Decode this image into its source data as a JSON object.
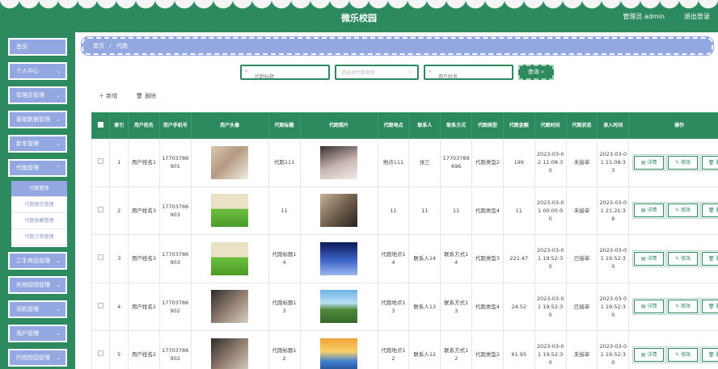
{
  "header": {
    "title": "微乐校园",
    "admin": "管理员 admin",
    "logout": "退出登录"
  },
  "sidebar": {
    "items": [
      {
        "label": "首页",
        "arrow": false
      },
      {
        "label": "个人中心",
        "arrow": true
      },
      {
        "label": "管理员管理",
        "arrow": true
      },
      {
        "label": "基础数据管理",
        "arrow": true
      },
      {
        "label": "新车管理",
        "arrow": true
      },
      {
        "label": "代跑管理",
        "arrow": true
      },
      {
        "label": "二手商品管理",
        "arrow": true
      },
      {
        "label": "失物招领管理",
        "arrow": true
      },
      {
        "label": "司机管理",
        "arrow": true
      },
      {
        "label": "用户管理",
        "arrow": true
      },
      {
        "label": "约拍校园管理",
        "arrow": true
      }
    ],
    "submenu": [
      "代跑管理",
      "代跑留言管理",
      "代跑收藏管理",
      "代跑订单管理"
    ]
  },
  "breadcrumb": {
    "home": "首页",
    "sep": "/",
    "current": "代跑"
  },
  "filters": {
    "title_placeholder": "代跑标题",
    "type_placeholder": "请选择代跑类型",
    "user_placeholder": "用户姓名",
    "search_label": "查询"
  },
  "toolbar": {
    "add": "新增",
    "delete": "删除"
  },
  "table": {
    "headers": [
      "索引",
      "用户姓名",
      "用户手机号",
      "用户头像",
      "代跑标题",
      "代跑照片",
      "代跑地点",
      "联系人",
      "联系方式",
      "代跑类型",
      "代跑金额",
      "代跑时间",
      "代跑状态",
      "录入时间",
      "操作"
    ],
    "actions": {
      "detail": "详情",
      "edit": "修改",
      "del": "删除"
    },
    "rows": [
      {
        "idx": "1",
        "name": "用户姓名1",
        "phone": "17703786901",
        "title": "代跑111",
        "place": "地点111",
        "contact": "张三",
        "tel": "17703789696",
        "type": "代跑类型2",
        "amount": "199",
        "time": "2023-03-02 11:08:30",
        "status": "未接单",
        "created": "2023-03-01 21:08:33"
      },
      {
        "idx": "2",
        "name": "用户姓名3",
        "phone": "17703786903",
        "title": "11",
        "place": "11",
        "contact": "11",
        "tel": "11",
        "type": "代跑类型4",
        "amount": "11",
        "time": "2023-03-01 00:00:00",
        "status": "未接单",
        "created": "2023-03-01 21:21:38"
      },
      {
        "idx": "3",
        "name": "用户姓名3",
        "phone": "17703786903",
        "title": "代跑标题14",
        "place": "代跑地点14",
        "contact": "联系人14",
        "tel": "联系方式14",
        "type": "代跑类型3",
        "amount": "221.47",
        "time": "2023-03-01 19:52:30",
        "status": "已接单",
        "created": "2023-03-01 19:52:30"
      },
      {
        "idx": "4",
        "name": "用户姓名2",
        "phone": "17703786902",
        "title": "代跑标题13",
        "place": "代跑地点13",
        "contact": "联系人13",
        "tel": "联系方式13",
        "type": "代跑类型4",
        "amount": "24.52",
        "time": "2023-03-01 19:52:30",
        "status": "已接单",
        "created": "2023-03-01 19:52:30"
      },
      {
        "idx": "5",
        "name": "用户姓名2",
        "phone": "17703786902",
        "title": "代跑标题12",
        "place": "代跑地点12",
        "contact": "联系人12",
        "tel": "联系方式12",
        "type": "代跑类型2",
        "amount": "61.95",
        "time": "2023-03-01 19:52:30",
        "status": "未接单",
        "created": "2023-03-01 19:52:30"
      }
    ]
  }
}
